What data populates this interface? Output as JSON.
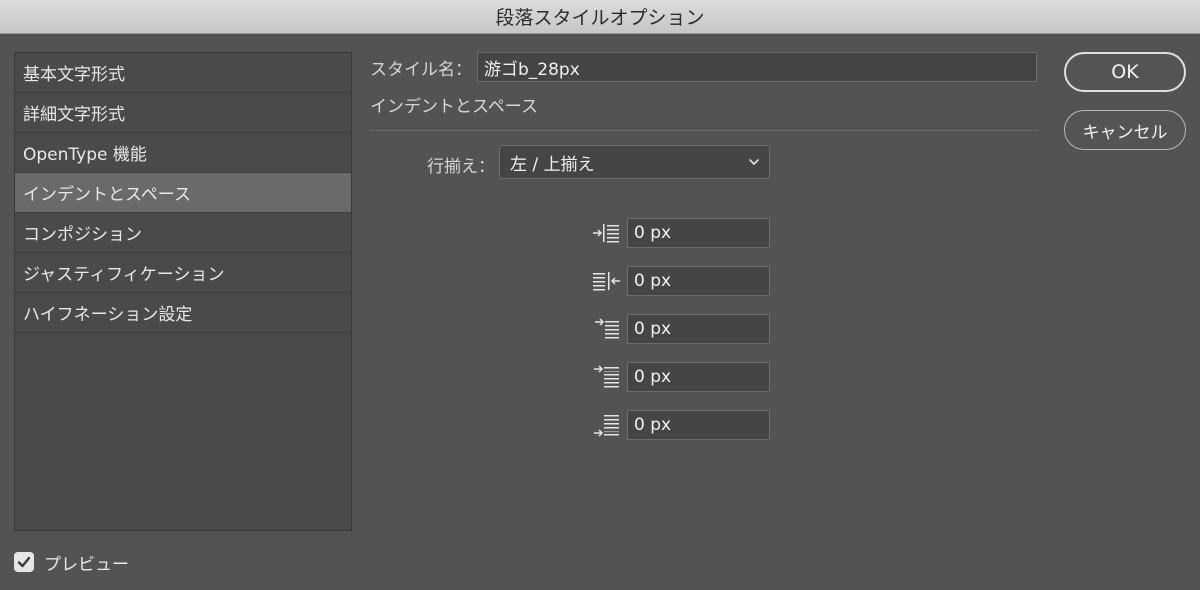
{
  "window": {
    "title": "段落スタイルオプション"
  },
  "categories": [
    {
      "label": "基本文字形式",
      "selected": false
    },
    {
      "label": "詳細文字形式",
      "selected": false
    },
    {
      "label": "OpenType 機能",
      "selected": false
    },
    {
      "label": "インデントとスペース",
      "selected": true
    },
    {
      "label": "コンポジション",
      "selected": false
    },
    {
      "label": "ジャスティフィケーション",
      "selected": false
    },
    {
      "label": "ハイフネーション設定",
      "selected": false
    }
  ],
  "preview": {
    "label": "プレビュー",
    "checked": true
  },
  "style_name": {
    "label": "スタイル名：",
    "value": "游ゴb_28px"
  },
  "section": {
    "title": "インデントとスペース"
  },
  "alignment": {
    "label": "行揃え：",
    "value": "左 / 上揃え"
  },
  "indents": {
    "left_indent": {
      "value": "0 px",
      "icon": "left-indent-icon"
    },
    "right_indent": {
      "value": "0 px",
      "icon": "right-indent-icon"
    },
    "first_line_indent": {
      "value": "0 px",
      "icon": "first-line-indent-icon"
    },
    "space_before": {
      "value": "0 px",
      "icon": "space-before-icon"
    },
    "space_after": {
      "value": "0 px",
      "icon": "space-after-icon"
    }
  },
  "buttons": {
    "ok": "OK",
    "cancel": "キャンセル"
  }
}
